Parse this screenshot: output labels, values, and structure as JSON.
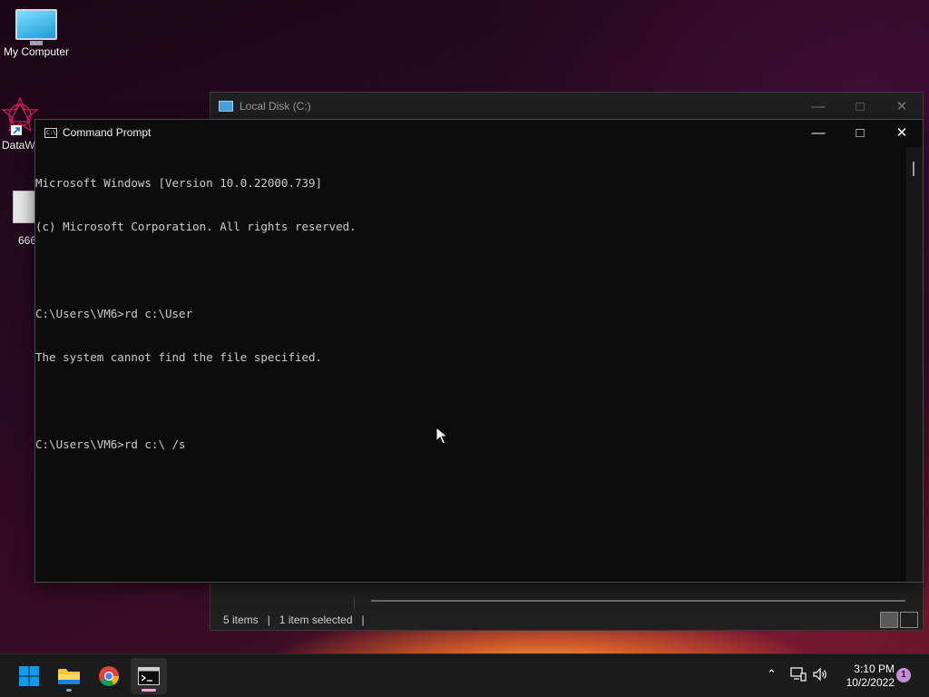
{
  "desktop": {
    "icons": [
      {
        "label": "My Computer"
      },
      {
        "label": "DataW"
      },
      {
        "label": "666"
      }
    ]
  },
  "explorer": {
    "title": "Local Disk (C:)",
    "status": {
      "items": "5 items",
      "selected": "1 item selected"
    }
  },
  "cmd": {
    "title": "Command Prompt",
    "icon_text": "C:\\",
    "lines": [
      "Microsoft Windows [Version 10.0.22000.739]",
      "(c) Microsoft Corporation. All rights reserved.",
      "",
      "C:\\Users\\VM6>rd c:\\User",
      "The system cannot find the file specified.",
      "",
      "C:\\Users\\VM6>rd c:\\ /s"
    ]
  },
  "taskbar": {
    "apps": [
      {
        "name": "start",
        "icon": "windows-icon"
      },
      {
        "name": "file-explorer",
        "icon": "folder-icon"
      },
      {
        "name": "chrome",
        "icon": "chrome-icon"
      },
      {
        "name": "command-prompt",
        "icon": "terminal-icon"
      }
    ],
    "clock": {
      "time": "3:10 PM",
      "date": "10/2/2022"
    },
    "notification_count": "1",
    "colors": {
      "accent": "#0f9bef",
      "active_indicator": "#f0a7d6"
    }
  }
}
